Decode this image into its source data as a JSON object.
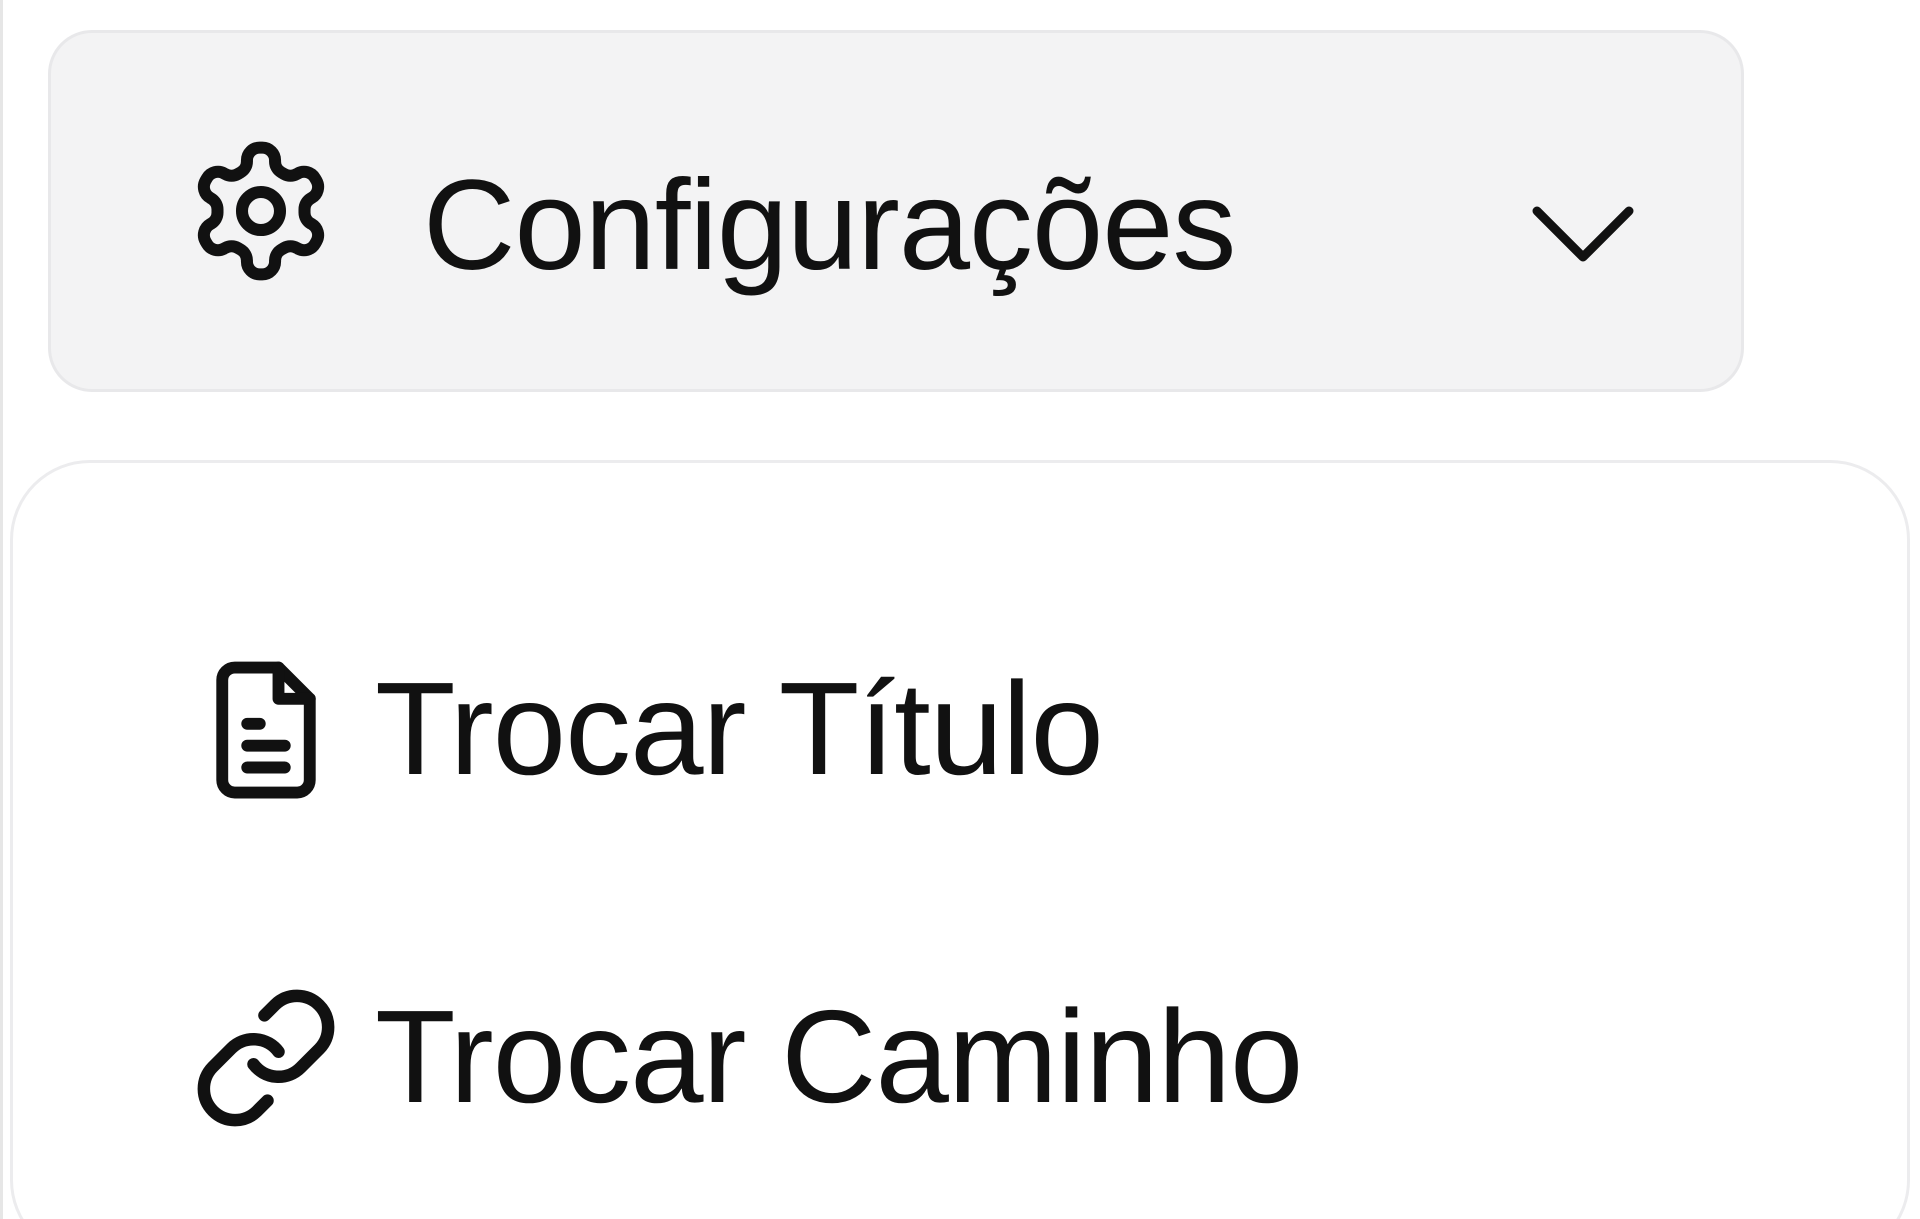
{
  "settings_button": {
    "label": "Configurações",
    "icon": "gear-icon",
    "chevron_icon": "chevron-down-icon"
  },
  "menu": {
    "items": [
      {
        "label": "Trocar Título",
        "icon": "document-icon"
      },
      {
        "label": "Trocar Caminho",
        "icon": "link-icon"
      }
    ]
  },
  "colors": {
    "button_bg": "#f3f3f4",
    "menu_bg": "#ffffff",
    "text": "#111111",
    "border": "#e8e8ea"
  }
}
